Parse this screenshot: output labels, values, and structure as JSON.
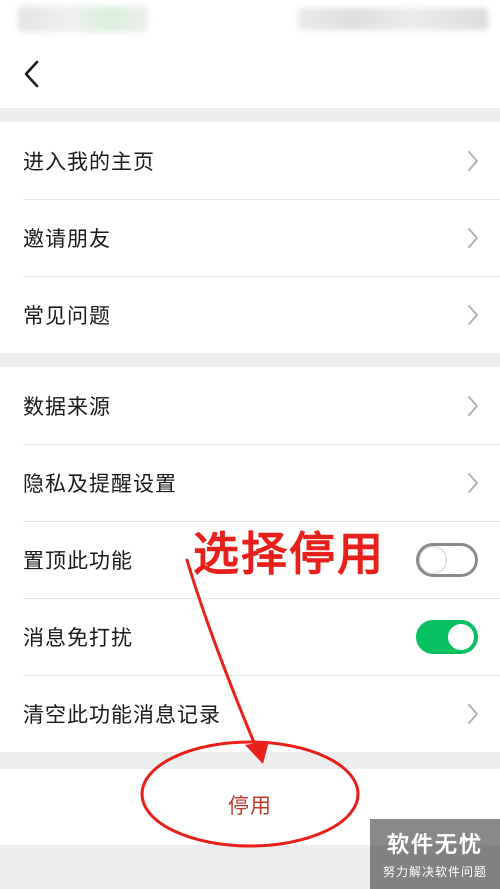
{
  "nav": {
    "back_icon": "chevron-left-icon"
  },
  "groups": [
    {
      "items": [
        {
          "label": "进入我的主页",
          "control": "chevron"
        },
        {
          "label": "邀请朋友",
          "control": "chevron"
        },
        {
          "label": "常见问题",
          "control": "chevron"
        }
      ]
    },
    {
      "items": [
        {
          "label": "数据来源",
          "control": "chevron"
        },
        {
          "label": "隐私及提醒设置",
          "control": "chevron"
        },
        {
          "label": "置顶此功能",
          "control": "toggle",
          "toggle_on": false
        },
        {
          "label": "消息免打扰",
          "control": "toggle",
          "toggle_on": true
        },
        {
          "label": "清空此功能消息记录",
          "control": "chevron"
        }
      ]
    }
  ],
  "disable_button": {
    "label": "停用"
  },
  "annotation": {
    "text": "选择停用",
    "color": "#e8201c"
  },
  "watermark": {
    "title": "软件无忧",
    "subtitle": "努力解决软件问题"
  },
  "colors": {
    "toggle_on": "#07c160",
    "disable_text": "#c0392b",
    "background": "#ededed"
  }
}
